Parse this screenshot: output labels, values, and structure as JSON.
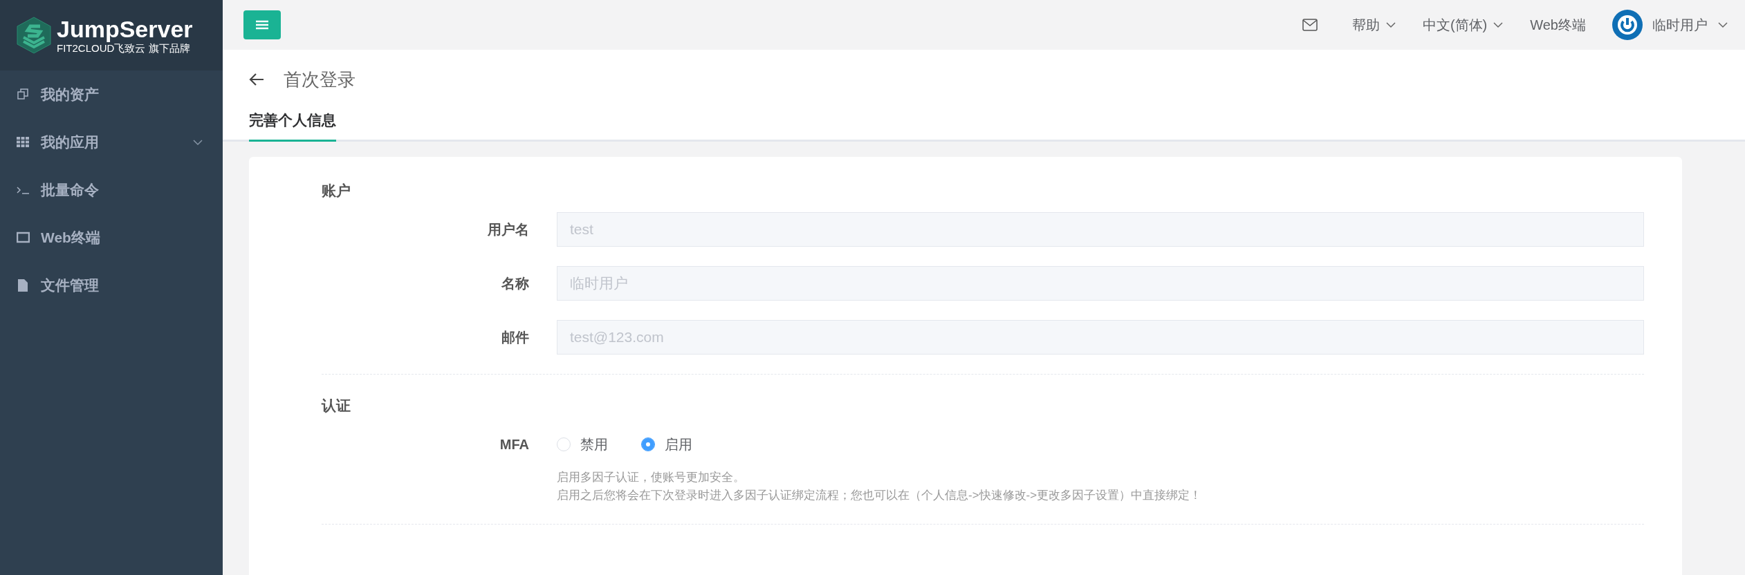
{
  "logo": {
    "title": "JumpServer",
    "subtitle": "FIT2CLOUD飞致云 旗下品牌"
  },
  "sidebar": {
    "items": [
      {
        "label": "我的资产",
        "expandable": false
      },
      {
        "label": "我的应用",
        "expandable": true
      },
      {
        "label": "批量命令",
        "expandable": false
      },
      {
        "label": "Web终端",
        "expandable": false
      },
      {
        "label": "文件管理",
        "expandable": false
      }
    ]
  },
  "header": {
    "items": [
      {
        "label": "帮助",
        "dropdown": true
      },
      {
        "label": "中文(简体)",
        "dropdown": true
      },
      {
        "label": "Web终端",
        "dropdown": false
      }
    ],
    "user": {
      "name": "临时用户"
    }
  },
  "page": {
    "title": "首次登录",
    "tabs": [
      {
        "label": "完善个人信息",
        "selected": true
      }
    ]
  },
  "sections": [
    {
      "title": "账户",
      "fields": [
        {
          "kind": "input",
          "label": "用户名",
          "value": "test",
          "disabled": true
        },
        {
          "kind": "input",
          "label": "名称",
          "value": "临时用户",
          "disabled": true
        },
        {
          "kind": "input",
          "label": "邮件",
          "value": "test@123.com",
          "disabled": true
        }
      ]
    },
    {
      "title": "认证",
      "fields": [
        {
          "kind": "radio",
          "label": "MFA",
          "options": [
            {
              "label": "禁用",
              "selected": false
            },
            {
              "label": "启用",
              "selected": true
            }
          ],
          "help": [
            "启用多因子认证，使账号更加安全。",
            "启用之后您将会在下次登录时进入多因子认证绑定流程；您也可以在（个人信息->快速修改->更改多因子设置）中直接绑定！"
          ]
        }
      ]
    }
  ]
}
